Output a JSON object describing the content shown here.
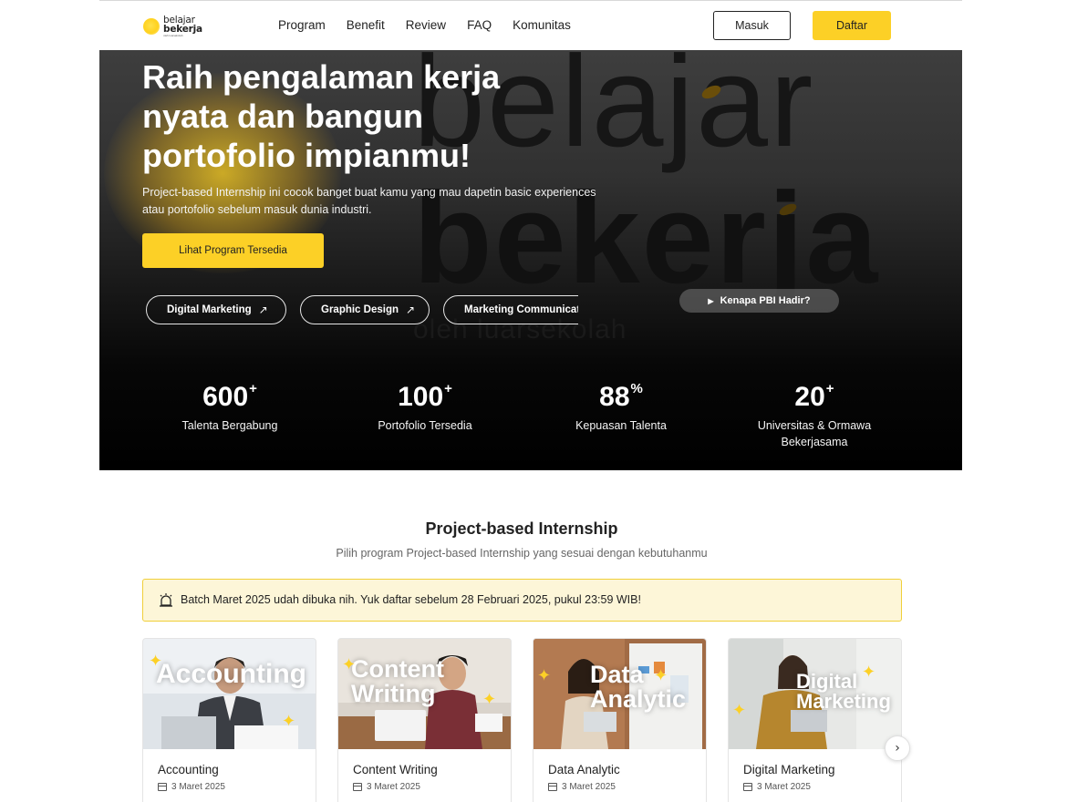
{
  "logo": {
    "line1": "belajar",
    "line2": "bekerja",
    "tagline": "oleh luarsekolah"
  },
  "nav": {
    "links": [
      "Program",
      "Benefit",
      "Review",
      "FAQ",
      "Komunitas"
    ],
    "login_label": "Masuk",
    "register_label": "Daftar"
  },
  "hero": {
    "title": "Raih pengalaman kerja nyata dan bangun portofolio impianmu!",
    "subtitle": "Project-based Internship ini cocok banget buat kamu yang mau dapetin basic experiences atau portofolio sebelum masuk dunia industri.",
    "cta_label": "Lihat Program Tersedia",
    "watermark_line1": "belajar",
    "watermark_line2": "bekerja",
    "watermark_line3": "oleh luarsekolah",
    "chips": [
      "Digital Marketing",
      "Graphic Design",
      "Marketing Communication"
    ],
    "video_button_label": "Kenapa PBI Hadir?",
    "icons": {
      "chip_arrow": "arrow-up-right-icon",
      "video": "play-icon"
    }
  },
  "stats": [
    {
      "number": "600",
      "suffix": "+",
      "label": "Talenta Bergabung"
    },
    {
      "number": "100",
      "suffix": "+",
      "label": "Portofolio Tersedia"
    },
    {
      "number": "88",
      "suffix": "%",
      "label": "Kepuasan Talenta"
    },
    {
      "number": "20",
      "suffix": "+",
      "label": "Universitas & Ormawa Bekerjasama"
    }
  ],
  "section": {
    "title": "Project-based Internship",
    "subtitle": "Pilih program Project-based Internship yang sesuai dengan kebutuhanmu"
  },
  "banner": {
    "text": "Batch Maret 2025 udah dibuka nih. Yuk daftar sebelum 28 Februari 2025, pukul 23:59 WIB!",
    "icon": "alarm-icon"
  },
  "cards": [
    {
      "title": "Accounting",
      "date": "3 Maret 2025",
      "overlay": "Accounting"
    },
    {
      "title": "Content Writing",
      "date": "3 Maret 2025",
      "overlay": "Content Writing"
    },
    {
      "title": "Data Analytic",
      "date": "3 Maret 2025",
      "overlay": "Data Analytic"
    },
    {
      "title": "Digital Marketing",
      "date": "3 Maret 2025",
      "overlay": "Digital Marketing"
    }
  ],
  "colors": {
    "accent": "#fcd026",
    "banner_bg": "#fdf6d8",
    "banner_border": "#f0cf3a",
    "hero_bg": "#000000"
  }
}
